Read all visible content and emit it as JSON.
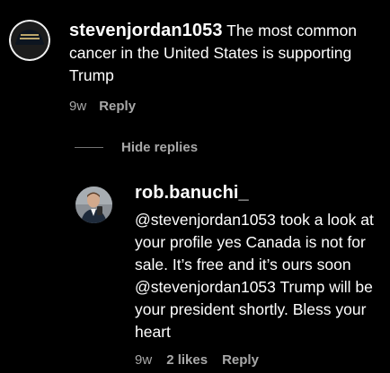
{
  "comment": {
    "username": "stevenjordan1053",
    "text": "The most common cancer in the United States is supporting Trump",
    "age": "9w",
    "reply_label": "Reply"
  },
  "hide_replies_label": "Hide replies",
  "reply": {
    "username": "rob.banuchi_",
    "text": "@stevenjordan1053 took a look at your profile yes Canada is not for sale. It’s free and it’s ours soon @stevenjordan1053 Trump will be your president shortly. Bless your heart",
    "age": "9w",
    "likes": "2 likes",
    "reply_label": "Reply"
  },
  "colors": {
    "background": "#000000",
    "text": "#ffffff",
    "secondary": "#a8a8a8"
  }
}
